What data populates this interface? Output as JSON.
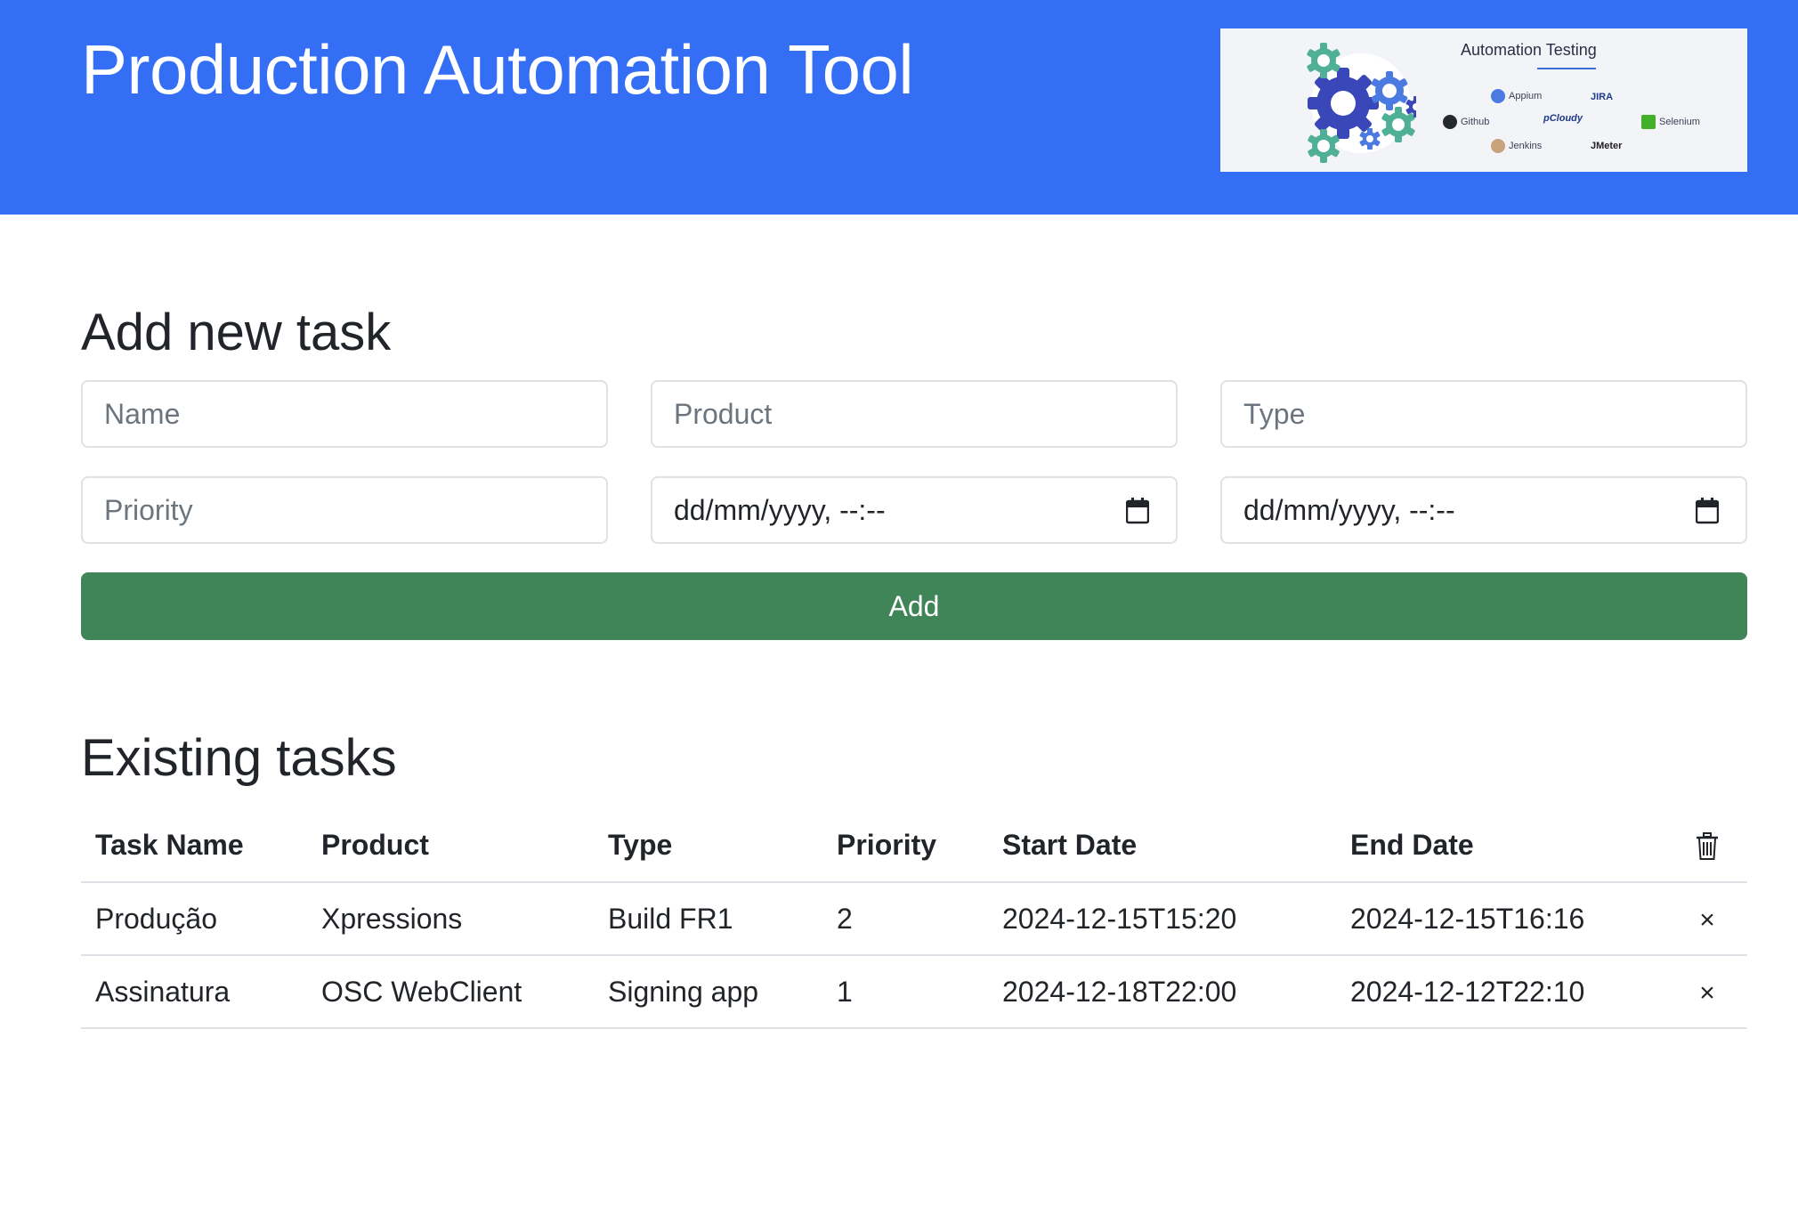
{
  "header": {
    "title": "Production Automation Tool",
    "banner": {
      "title": "Automation Testing",
      "tools": [
        "Appium",
        "JIRA",
        "Github",
        "pCloudy",
        "Selenium",
        "Jenkins",
        "JMeter"
      ]
    }
  },
  "add_section": {
    "title": "Add new task",
    "fields": {
      "name_placeholder": "Name",
      "product_placeholder": "Product",
      "type_placeholder": "Type",
      "priority_placeholder": "Priority",
      "start_date_value": "dd/mm/yyyy, --:--",
      "end_date_value": "dd/mm/yyyy, --:--"
    },
    "add_label": "Add"
  },
  "tasks_section": {
    "title": "Existing tasks",
    "columns": [
      "Task Name",
      "Product",
      "Type",
      "Priority",
      "Start Date",
      "End Date"
    ],
    "rows": [
      {
        "name": "Produção",
        "product": "Xpressions",
        "type": "Build FR1",
        "priority": "2",
        "start": "2024-12-15T15:20",
        "end": "2024-12-15T16:16",
        "delete": "×"
      },
      {
        "name": "Assinatura",
        "product": "OSC WebClient",
        "type": "Signing app",
        "priority": "1",
        "start": "2024-12-18T22:00",
        "end": "2024-12-12T22:10",
        "delete": "×"
      }
    ]
  },
  "colors": {
    "header_bg": "#346ef5",
    "add_button_bg": "#408558",
    "border": "#dee2e6"
  },
  "icons": [
    "gears-illustration",
    "calendar-icon",
    "trash-icon",
    "close-icon"
  ]
}
